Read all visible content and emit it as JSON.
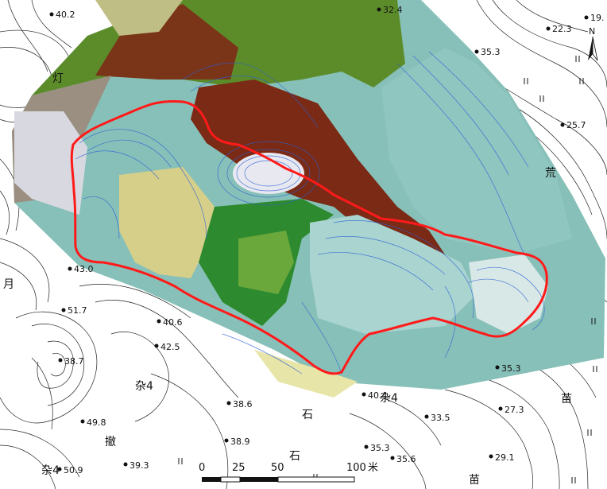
{
  "north_arrow": {
    "letter": "N",
    "icon": "north-arrow-icon"
  },
  "boundary_color": "#ff1a1a",
  "elevation_points": [
    {
      "id": "e1",
      "text": "40.2"
    },
    {
      "id": "e2",
      "text": "32.4"
    },
    {
      "id": "e3",
      "text": "19."
    },
    {
      "id": "e4",
      "text": "22.3"
    },
    {
      "id": "e5",
      "text": "35.3"
    },
    {
      "id": "e6",
      "text": "25.7"
    },
    {
      "id": "e7",
      "text": "43.0"
    },
    {
      "id": "e8",
      "text": "51.7"
    },
    {
      "id": "e9",
      "text": "40.6"
    },
    {
      "id": "e10",
      "text": "42.5"
    },
    {
      "id": "e11",
      "text": "38.7"
    },
    {
      "id": "e12",
      "text": "35.3"
    },
    {
      "id": "e13",
      "text": "40.4"
    },
    {
      "id": "e14",
      "text": "38.6"
    },
    {
      "id": "e15",
      "text": "33.5"
    },
    {
      "id": "e16",
      "text": "27.3"
    },
    {
      "id": "e17",
      "text": "49.8"
    },
    {
      "id": "e18",
      "text": "38.9"
    },
    {
      "id": "e19",
      "text": "39.3"
    },
    {
      "id": "e20",
      "text": "35.3"
    },
    {
      "id": "e21",
      "text": "35.6"
    },
    {
      "id": "e22",
      "text": "29.1"
    },
    {
      "id": "e23",
      "text": "50.9"
    }
  ],
  "land_labels": [
    {
      "id": "l1",
      "text": "杂4"
    },
    {
      "id": "l2",
      "text": "石"
    },
    {
      "id": "l3",
      "text": "石"
    },
    {
      "id": "l4",
      "text": "苗"
    },
    {
      "id": "l5",
      "text": "苗"
    },
    {
      "id": "l6",
      "text": "杂4"
    },
    {
      "id": "l7",
      "text": "杂4"
    },
    {
      "id": "l8",
      "text": "撤"
    },
    {
      "id": "l9",
      "text": "荒"
    },
    {
      "id": "l10",
      "text": "月"
    },
    {
      "id": "l11",
      "text": "灯"
    }
  ],
  "scale_bar": {
    "ticks": [
      "0",
      "25",
      "50",
      "100"
    ],
    "unit": "米"
  }
}
